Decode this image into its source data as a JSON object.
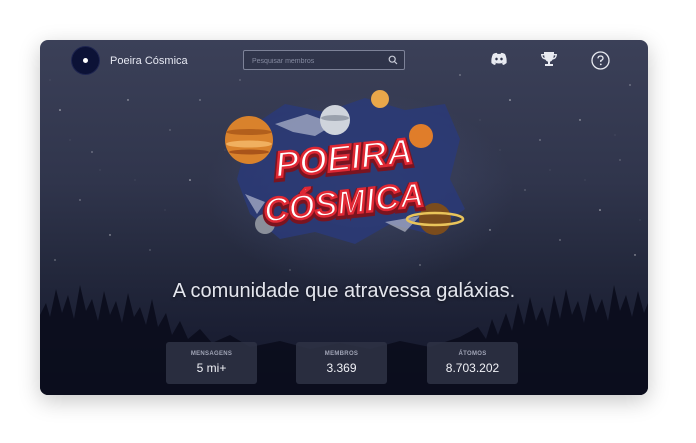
{
  "header": {
    "brand_name": "Poeira Cósmica",
    "search_placeholder": "Pesquisar membros",
    "icons": [
      "discord-icon",
      "trophy-icon",
      "help-icon",
      "search-icon"
    ]
  },
  "hero": {
    "logo_line1": "POEIRA",
    "logo_line2": "CÓSMICA",
    "tagline": "A comunidade que atravessa galáxias."
  },
  "stats": [
    {
      "label": "MENSAGENS",
      "value": "5 mi+"
    },
    {
      "label": "MEMBROS",
      "value": "3.369"
    },
    {
      "label": "ÁTOMOS",
      "value": "8.703.202"
    }
  ],
  "colors": {
    "sky_top": "#3b4058",
    "sky_bottom": "#12152a",
    "logo_red": "#e02834",
    "logo_blue": "#1f3f9c",
    "stat_bg": "#2e3244"
  }
}
